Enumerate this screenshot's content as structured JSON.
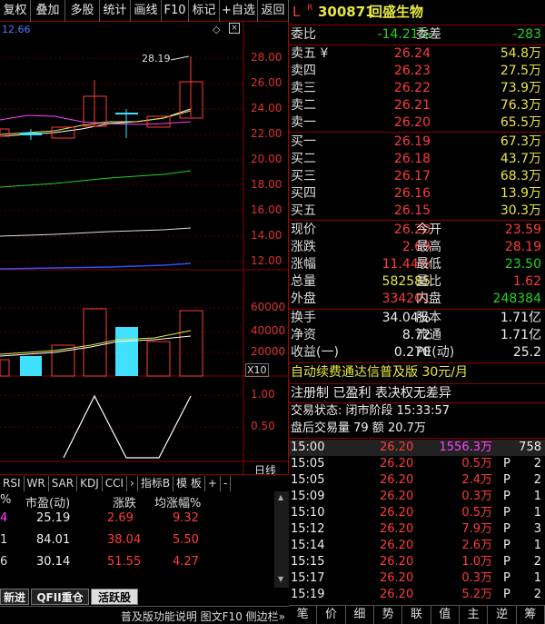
{
  "toolbar": [
    "复权",
    "叠加",
    "多股",
    "统计",
    "画线",
    "F10",
    "标记",
    "+自选",
    "返回"
  ],
  "chart": {
    "price_ticks": [
      "28.00",
      "26.00",
      "24.00",
      "22.00",
      "20.00",
      "18.00",
      "16.00",
      "14.00",
      "12.00"
    ],
    "corner_value": "12.66",
    "high_label": "28.19",
    "vol_ticks": [
      "60000",
      "40000",
      "20000"
    ],
    "vol_unit": "X10",
    "ind_ticks": [
      "1.00",
      "0.50"
    ],
    "period_label": "日线"
  },
  "indicator_tabs": [
    "RSI",
    "WR",
    "SAR",
    "KDJ",
    "CCI",
    "›",
    "指标B",
    "模 板",
    "+",
    "-"
  ],
  "ranking": {
    "headers": [
      "%",
      "市盈(动)",
      "涨跌",
      "均涨幅%"
    ],
    "rows": [
      {
        "a": "4",
        "pe": "25.19",
        "chg": "2.69",
        "avg": "9.32"
      },
      {
        "a": "1",
        "pe": "84.01",
        "chg": "38.04",
        "avg": "5.50"
      },
      {
        "a": "6",
        "pe": "30.14",
        "chg": "51.55",
        "avg": "4.27"
      }
    ]
  },
  "bottom_tabs": [
    "新进",
    "QFII重仓",
    "活跃股"
  ],
  "statusbar": "普及版功能说明 图文F10 侧边栏»",
  "quote": {
    "prefix": "L",
    "sup": "R",
    "code": "300871",
    "name": "回盛生物",
    "webi_label": "委比",
    "webi": "-14.21%",
    "weicha_label": "委差",
    "weicha": "-283",
    "sell": [
      {
        "label": "卖五 ¥",
        "price": "26.24",
        "vol": "54.8万"
      },
      {
        "label": "卖四",
        "price": "26.23",
        "vol": "27.5万"
      },
      {
        "label": "卖三",
        "price": "26.22",
        "vol": "73.9万"
      },
      {
        "label": "卖二",
        "price": "26.21",
        "vol": "76.3万"
      },
      {
        "label": "卖一",
        "price": "26.20",
        "vol": "65.5万"
      }
    ],
    "buy": [
      {
        "label": "买一",
        "price": "26.19",
        "vol": "67.3万"
      },
      {
        "label": "买二",
        "price": "26.18",
        "vol": "43.7万"
      },
      {
        "label": "买三",
        "price": "26.17",
        "vol": "68.3万"
      },
      {
        "label": "买四",
        "price": "26.16",
        "vol": "13.9万"
      },
      {
        "label": "买五",
        "price": "26.15",
        "vol": "30.3万"
      }
    ],
    "stats": [
      {
        "l1": "现价",
        "v1": "26.20",
        "c1": "red",
        "l2": "今开",
        "v2": "23.59",
        "c2": "red"
      },
      {
        "l1": "涨跌",
        "v1": "2.69",
        "c1": "red",
        "l2": "最高",
        "v2": "28.19",
        "c2": "red"
      },
      {
        "l1": "涨幅",
        "v1": "11.44%",
        "c1": "red",
        "l2": "最低",
        "v2": "23.50",
        "c2": "grn"
      },
      {
        "l1": "总量",
        "v1": "582585",
        "c1": "yel",
        "l2": "量比",
        "v2": "1.62",
        "c2": "red"
      },
      {
        "l1": "外盘",
        "v1": "334201",
        "c1": "red",
        "l2": "内盘",
        "v2": "248384",
        "c2": "grn"
      }
    ],
    "stats2": [
      {
        "l1": "换手",
        "v1": "34.04%",
        "l2": "股本",
        "v2": "1.71亿"
      },
      {
        "l1": "净资",
        "v1": "8.72",
        "l2": "流通",
        "v2": "1.71亿"
      },
      {
        "l1": "收益(一)",
        "v1": "0.270",
        "l2": "PE(动)",
        "v2": "25.2"
      }
    ],
    "ad_line": "自动续费通达信普及版 30元/月",
    "info_line": "注册制 已盈利 表决权无差异",
    "trade_status": "交易状态: 闭市阶段 15:33:57",
    "after_hours": "盘后交易量 79 额 20.7万"
  },
  "ticks": [
    {
      "t": "15:00",
      "p": "26.20",
      "v": "1556.3万",
      "f": "",
      "n": "758",
      "hl": true
    },
    {
      "t": "15:05",
      "p": "26.20",
      "v": "0.5万",
      "f": "P",
      "n": "2"
    },
    {
      "t": "15:05",
      "p": "26.20",
      "v": "2.4万",
      "f": "P",
      "n": "2"
    },
    {
      "t": "15:09",
      "p": "26.20",
      "v": "0.3万",
      "f": "P",
      "n": "1"
    },
    {
      "t": "15:10",
      "p": "26.20",
      "v": "0.5万",
      "f": "P",
      "n": "1"
    },
    {
      "t": "15:12",
      "p": "26.20",
      "v": "7.9万",
      "f": "P",
      "n": "3"
    },
    {
      "t": "15:14",
      "p": "26.20",
      "v": "2.6万",
      "f": "P",
      "n": "1"
    },
    {
      "t": "15:15",
      "p": "26.20",
      "v": "1.0万",
      "f": "P",
      "n": "2"
    },
    {
      "t": "15:17",
      "p": "26.20",
      "v": "0.3万",
      "f": "P",
      "n": "1"
    },
    {
      "t": "15:19",
      "p": "26.20",
      "v": "5.2万",
      "f": "P",
      "n": "2"
    }
  ],
  "rp_bottom": [
    "笔",
    "价",
    "细",
    "势",
    "联",
    "值",
    "主",
    "逆",
    "筹"
  ]
}
